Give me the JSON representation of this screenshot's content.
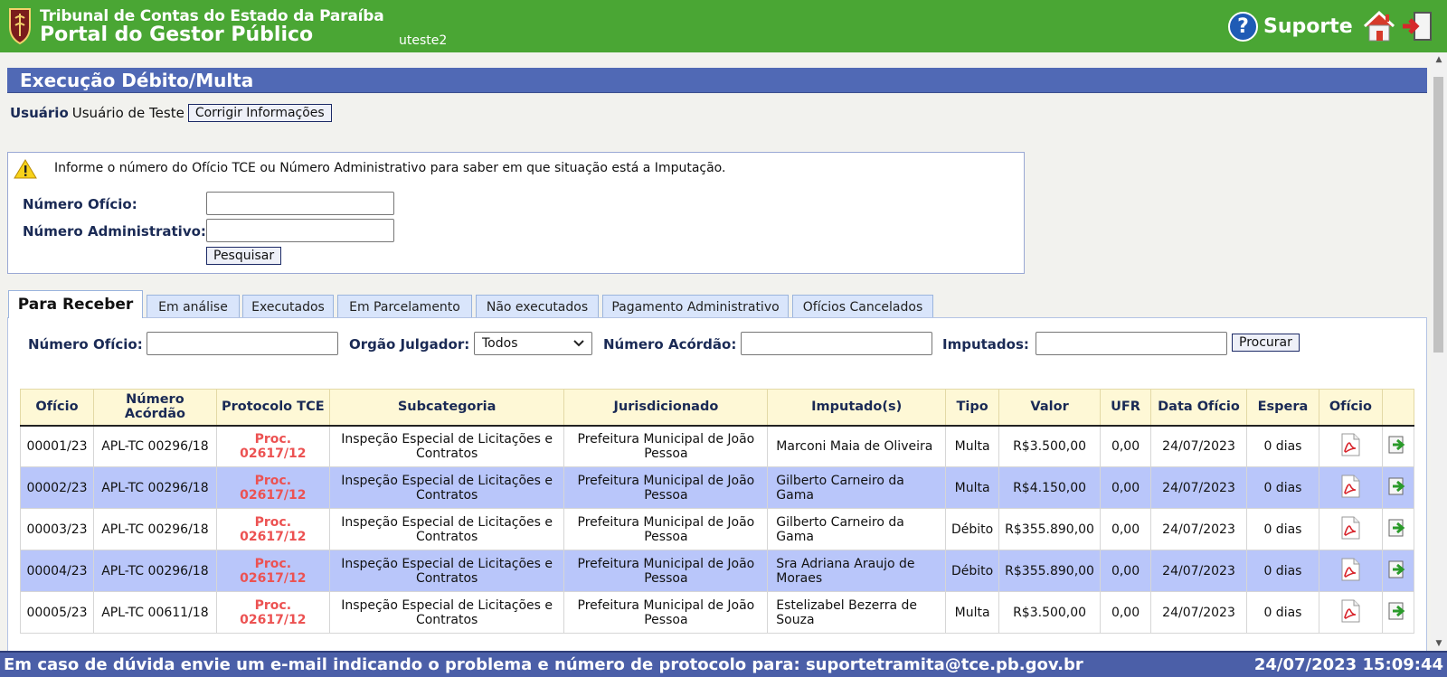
{
  "header": {
    "org_line1": "Tribunal de Contas do Estado da Paraíba",
    "org_line2": "Portal do Gestor Público",
    "username": "uteste2",
    "support_label": "Suporte"
  },
  "page": {
    "title": "Execução Débito/Multa",
    "user_label": "Usuário",
    "user_value": "Usuário de Teste",
    "fix_info_button": "Corrigir Informações"
  },
  "search": {
    "info_text": "Informe o número do Ofício TCE ou Número Administrativo para saber em que situação está a Imputação.",
    "oficio_label": "Número Ofício:",
    "oficio_value": "",
    "admin_label": "Número Administrativo:",
    "admin_value": "",
    "search_button": "Pesquisar"
  },
  "tabs": [
    {
      "label": "Para Receber",
      "active": true
    },
    {
      "label": "Em análise",
      "active": false
    },
    {
      "label": "Executados",
      "active": false
    },
    {
      "label": "Em Parcelamento",
      "active": false
    },
    {
      "label": "Não executados",
      "active": false
    },
    {
      "label": "Pagamento Administrativo",
      "active": false
    },
    {
      "label": "Ofícios Cancelados",
      "active": false
    }
  ],
  "filters": {
    "oficio_label": "Número Ofício:",
    "oficio_value": "",
    "orgao_label": "Orgão Julgador:",
    "orgao_selected": "Todos",
    "acordao_label": "Número Acórdão:",
    "acordao_value": "",
    "imputados_label": "Imputados:",
    "imputados_value": "",
    "search_button": "Procurar"
  },
  "table": {
    "headers": [
      "Ofício",
      "Número Acórdão",
      "Protocolo TCE",
      "Subcategoria",
      "Jurisdicionado",
      "Imputado(s)",
      "Tipo",
      "Valor",
      "UFR",
      "Data Ofício",
      "Espera",
      "Ofício",
      ""
    ],
    "rows": [
      {
        "oficio": "00001/23",
        "acordao": "APL-TC 00296/18",
        "protocolo": "Proc. 02617/12",
        "subcategoria": "Inspeção Especial de Licitações e Contratos",
        "jurisdicionado": "Prefeitura Municipal de João Pessoa",
        "imputado": "Marconi Maia de Oliveira",
        "tipo": "Multa",
        "valor": "R$3.500,00",
        "ufr": "0,00",
        "data": "24/07/2023",
        "espera": "0 dias"
      },
      {
        "oficio": "00002/23",
        "acordao": "APL-TC 00296/18",
        "protocolo": "Proc. 02617/12",
        "subcategoria": "Inspeção Especial de Licitações e Contratos",
        "jurisdicionado": "Prefeitura Municipal de João Pessoa",
        "imputado": "Gilberto Carneiro da Gama",
        "tipo": "Multa",
        "valor": "R$4.150,00",
        "ufr": "0,00",
        "data": "24/07/2023",
        "espera": "0 dias"
      },
      {
        "oficio": "00003/23",
        "acordao": "APL-TC 00296/18",
        "protocolo": "Proc. 02617/12",
        "subcategoria": "Inspeção Especial de Licitações e Contratos",
        "jurisdicionado": "Prefeitura Municipal de João Pessoa",
        "imputado": "Gilberto Carneiro da Gama",
        "tipo": "Débito",
        "valor": "R$355.890,00",
        "ufr": "0,00",
        "data": "24/07/2023",
        "espera": "0 dias"
      },
      {
        "oficio": "00004/23",
        "acordao": "APL-TC 00296/18",
        "protocolo": "Proc. 02617/12",
        "subcategoria": "Inspeção Especial de Licitações e Contratos",
        "jurisdicionado": "Prefeitura Municipal de João Pessoa",
        "imputado": "Sra Adriana Araujo de Moraes",
        "tipo": "Débito",
        "valor": "R$355.890,00",
        "ufr": "0,00",
        "data": "24/07/2023",
        "espera": "0 dias"
      },
      {
        "oficio": "00005/23",
        "acordao": "APL-TC 00611/18",
        "protocolo": "Proc. 02617/12",
        "subcategoria": "Inspeção Especial de Licitações e Contratos",
        "jurisdicionado": "Prefeitura Municipal de João Pessoa",
        "imputado": "Estelizabel Bezerra de Souza",
        "tipo": "Multa",
        "valor": "R$3.500,00",
        "ufr": "0,00",
        "data": "24/07/2023",
        "espera": "0 dias"
      }
    ]
  },
  "icons": {
    "crest": "tce-crest-icon",
    "support": "help-question-icon",
    "home": "home-icon",
    "exit": "exit-door-icon",
    "warning": "warning-triangle-icon",
    "pdf": "pdf-file-icon",
    "action": "green-arrow-icon"
  },
  "colors": {
    "header_green": "#4aa634",
    "title_blue": "#5069b5",
    "row_alt": "#b9c6fa",
    "table_header": "#fef8d6",
    "protocol_red": "#ec5252",
    "footer_blue": "#4b5fa8"
  },
  "footer": {
    "message": "Em caso de dúvida envie um e-mail indicando o problema e número de protocolo para: suportetramita@tce.pb.gov.br",
    "datetime": "24/07/2023 15:09:44"
  }
}
